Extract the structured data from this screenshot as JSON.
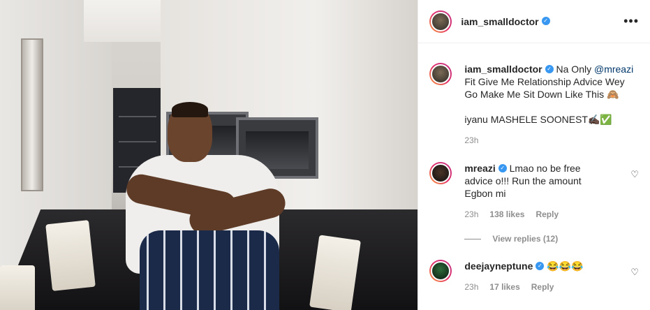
{
  "header": {
    "username": "iam_smalldoctor",
    "more_icon": "more-horizontal-icon"
  },
  "caption": {
    "username": "iam_smalldoctor",
    "text_before": " Na Only ",
    "mention": "@mreazi",
    "text_after": " Fit Give Me Relationship Advice Wey Go Make Me Sit Down Like This 🙈",
    "line2": "iyanu MASHELE SOONEST✍🏿✅",
    "time": "23h"
  },
  "comments": [
    {
      "username": "mreazi",
      "text": "Lmao no be free advice o!!! Run the amount Egbon mi",
      "time": "23h",
      "likes": "138 likes",
      "reply": "Reply",
      "view_replies": "View replies (12)"
    },
    {
      "username": "deejayneptune",
      "text": "😂😂😂",
      "time": "23h",
      "likes": "17 likes",
      "reply": "Reply"
    }
  ],
  "colors": {
    "verified": "#3897f0",
    "mention": "#00376b",
    "muted": "#8e8e8e"
  }
}
